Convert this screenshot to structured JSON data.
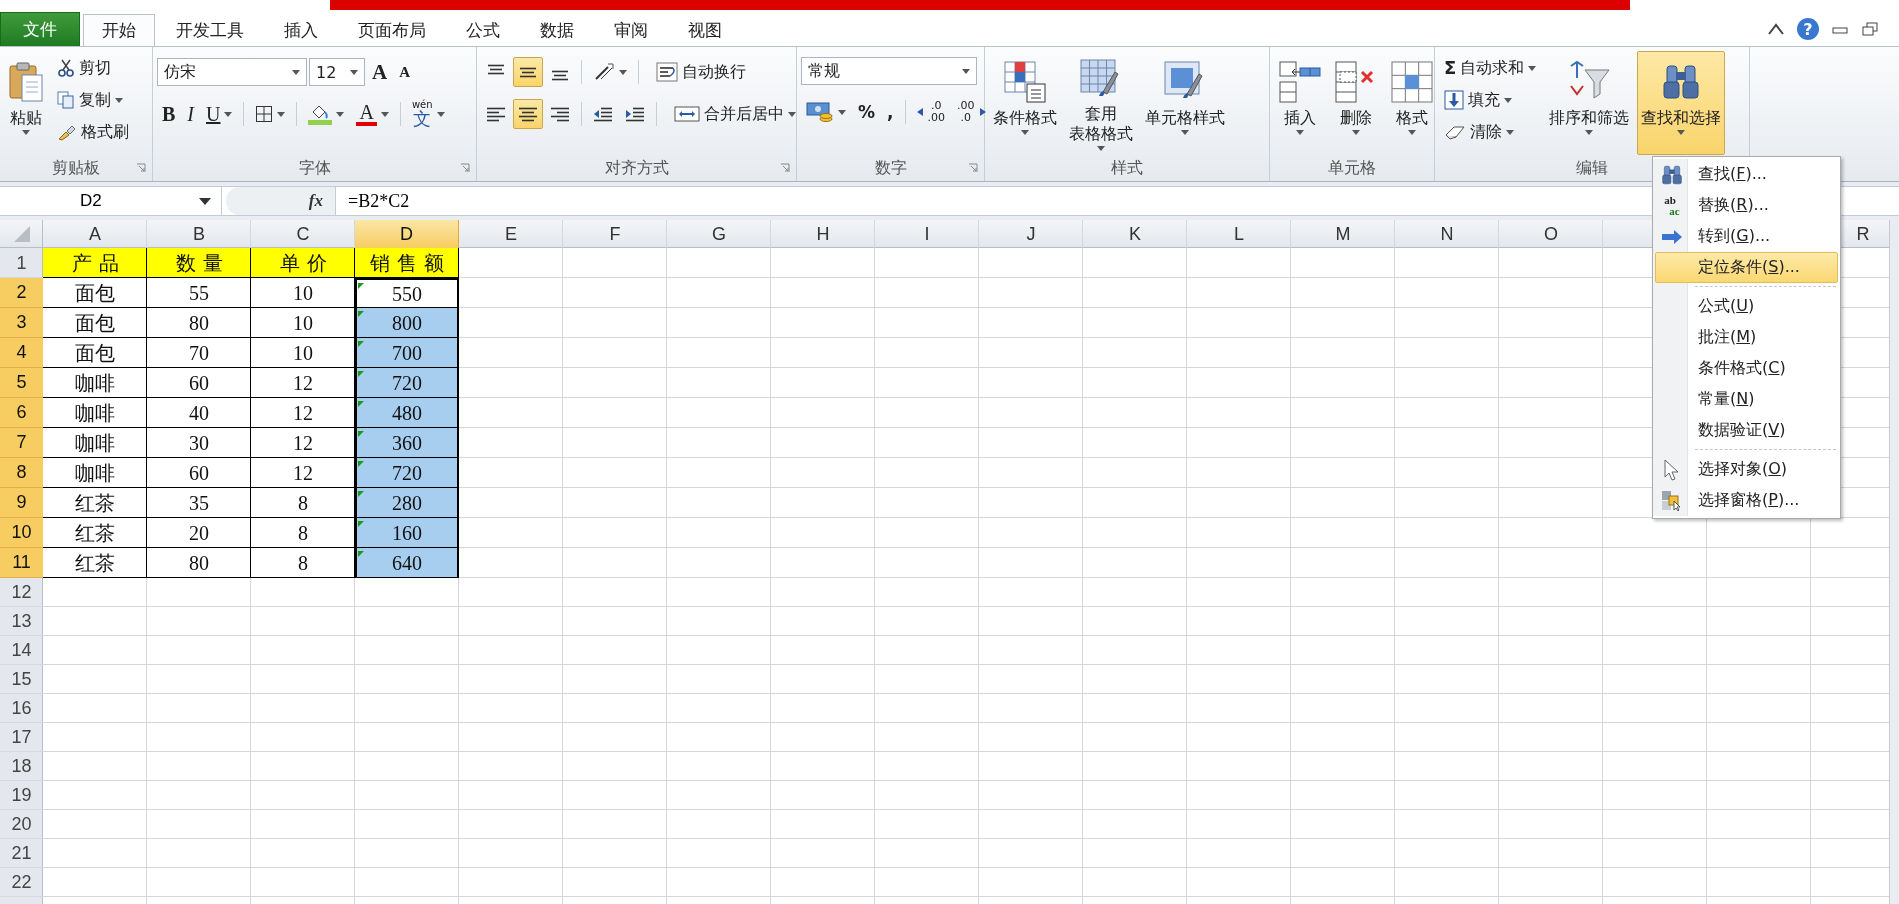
{
  "title_bar": {
    "help": "?"
  },
  "tabs": [
    {
      "label": "文件",
      "kind": "file",
      "selected": false
    },
    {
      "label": "开始",
      "kind": "tab",
      "selected": true
    },
    {
      "label": "开发工具",
      "kind": "tab",
      "selected": false
    },
    {
      "label": "插入",
      "kind": "tab",
      "selected": false
    },
    {
      "label": "页面布局",
      "kind": "tab",
      "selected": false
    },
    {
      "label": "公式",
      "kind": "tab",
      "selected": false
    },
    {
      "label": "数据",
      "kind": "tab",
      "selected": false
    },
    {
      "label": "审阅",
      "kind": "tab",
      "selected": false
    },
    {
      "label": "视图",
      "kind": "tab",
      "selected": false
    }
  ],
  "ribbon": [
    {
      "label": "剪贴板",
      "launcher": true,
      "controls": [
        {
          "kind": "paste",
          "lines": [
            "粘贴"
          ],
          "dropdown": true,
          "pressed": false
        },
        {
          "kind": "stack",
          "items": [
            {
              "kind": "cut",
              "label": "剪切",
              "dropdown": false
            },
            {
              "kind": "copy",
              "label": "复制",
              "dropdown": true
            },
            {
              "kind": "painter",
              "label": "格式刷",
              "dropdown": false
            }
          ]
        }
      ]
    },
    {
      "label": "字体",
      "launcher": true,
      "controls": [
        {
          "kind": "rows",
          "rows": [
            {
              "items": [
                {
                  "kind": "font-field",
                  "value": "仿宋"
                },
                {
                  "kind": "size-field",
                  "value": "12"
                },
                {
                  "kind": "grow",
                  "glyph": "A"
                },
                {
                  "kind": "shrink",
                  "glyph": "A"
                }
              ]
            },
            {
              "items": [
                {
                  "kind": "bold",
                  "glyph": "B"
                },
                {
                  "kind": "italic",
                  "glyph": "I"
                },
                {
                  "kind": "underline",
                  "glyph": "U",
                  "dropdown": true
                },
                {
                  "kind": "sep"
                },
                {
                  "kind": "border",
                  "dropdown": true
                },
                {
                  "kind": "sep"
                },
                {
                  "kind": "fill",
                  "dropdown": true
                },
                {
                  "kind": "font-color",
                  "glyph": "A",
                  "dropdown": true
                },
                {
                  "kind": "sep"
                },
                {
                  "kind": "phonetic",
                  "glyph": "文",
                  "sup": "wén",
                  "dropdown": true
                }
              ]
            }
          ]
        }
      ]
    },
    {
      "label": "对齐方式",
      "launcher": true,
      "controls": [
        {
          "kind": "rows",
          "rows": [
            {
              "items": [
                {
                  "kind": "align-top",
                  "pressed": false
                },
                {
                  "kind": "align-middle",
                  "pressed": true
                },
                {
                  "kind": "align-bottom",
                  "pressed": false
                },
                {
                  "kind": "sep"
                },
                {
                  "kind": "orientation",
                  "dropdown": true
                },
                {
                  "kind": "sep"
                },
                {
                  "kind": "wrap",
                  "label": "自动换行"
                }
              ]
            },
            {
              "items": [
                {
                  "kind": "align-left",
                  "pressed": false
                },
                {
                  "kind": "align-center",
                  "pressed": true
                },
                {
                  "kind": "align-right",
                  "pressed": false
                },
                {
                  "kind": "sep"
                },
                {
                  "kind": "indent-less"
                },
                {
                  "kind": "indent-more"
                },
                {
                  "kind": "sep"
                },
                {
                  "kind": "merge",
                  "label": "合并后居中",
                  "dropdown": true
                }
              ]
            }
          ]
        }
      ]
    },
    {
      "label": "数字",
      "launcher": true,
      "controls": [
        {
          "kind": "rows",
          "rows": [
            {
              "items": [
                {
                  "kind": "format-field",
                  "value": "常规"
                }
              ]
            },
            {
              "items": [
                {
                  "kind": "currency",
                  "dropdown": true
                },
                {
                  "kind": "percent",
                  "glyph": "%"
                },
                {
                  "kind": "comma",
                  "glyph": ","
                },
                {
                  "kind": "sep"
                },
                {
                  "kind": "decimal-more",
                  "glyph": ".0",
                  "glyph2": ".00"
                },
                {
                  "kind": "decimal-less",
                  "glyph": ".00",
                  "glyph2": ".0"
                }
              ]
            }
          ]
        }
      ]
    },
    {
      "label": "样式",
      "launcher": false,
      "controls": [
        {
          "kind": "conditional",
          "lines": [
            "条件格式"
          ],
          "dropdown": true,
          "pressed": false
        },
        {
          "kind": "table-format",
          "lines": [
            "套用",
            "表格格式"
          ],
          "dropdown": true,
          "pressed": false
        },
        {
          "kind": "cell-styles",
          "lines": [
            "单元格样式"
          ],
          "dropdown": true,
          "pressed": false
        }
      ]
    },
    {
      "label": "单元格",
      "launcher": false,
      "controls": [
        {
          "kind": "insert",
          "lines": [
            "插入"
          ],
          "dropdown": true,
          "pressed": false
        },
        {
          "kind": "delete",
          "lines": [
            "删除"
          ],
          "dropdown": true,
          "pressed": false
        },
        {
          "kind": "format",
          "lines": [
            "格式"
          ],
          "dropdown": true,
          "pressed": false
        }
      ]
    },
    {
      "label": "编辑",
      "launcher": false,
      "controls": [
        {
          "kind": "stack",
          "items": [
            {
              "kind": "autosum",
              "glyph": "Σ",
              "label": "自动求和",
              "dropdown": true
            },
            {
              "kind": "fill-down",
              "label": "填充",
              "dropdown": true
            },
            {
              "kind": "clear",
              "label": "清除",
              "dropdown": true
            }
          ]
        },
        {
          "kind": "sort-filter",
          "lines": [
            "排序和筛选"
          ],
          "dropdown": true,
          "pressed": false
        },
        {
          "kind": "find",
          "lines": [
            "查找和选择"
          ],
          "dropdown": true,
          "pressed": true
        }
      ]
    }
  ],
  "formula_bar": {
    "name_box": "D2",
    "fx": "fx",
    "formula": "=B2*C2"
  },
  "sheet": {
    "columns": [
      {
        "label": "A",
        "highlighted": false
      },
      {
        "label": "B",
        "highlighted": false
      },
      {
        "label": "C",
        "highlighted": false
      },
      {
        "label": "D",
        "highlighted": true
      },
      {
        "label": "E",
        "highlighted": false
      },
      {
        "label": "F",
        "highlighted": false
      },
      {
        "label": "G",
        "highlighted": false
      },
      {
        "label": "H",
        "highlighted": false
      },
      {
        "label": "I",
        "highlighted": false
      },
      {
        "label": "J",
        "highlighted": false
      },
      {
        "label": "K",
        "highlighted": false
      },
      {
        "label": "L",
        "highlighted": false
      },
      {
        "label": "M",
        "highlighted": false
      },
      {
        "label": "N",
        "highlighted": false
      },
      {
        "label": "O",
        "highlighted": false
      },
      {
        "highlighted": false
      },
      {
        "label": "R",
        "highlighted": false
      }
    ],
    "rows": [
      {
        "row": "1",
        "kind": "header",
        "highlighted": false,
        "cells": [
          "产品",
          "数量",
          "单价"
        ],
        "d": {
          "text": "销售额",
          "selected": false,
          "active": false,
          "flagged": false
        }
      },
      {
        "row": "2",
        "kind": "data",
        "highlighted": true,
        "cells": [
          "面包",
          "55",
          "10"
        ],
        "d": {
          "text": "550",
          "selected": true,
          "active": true,
          "flagged": true
        }
      },
      {
        "row": "3",
        "kind": "data",
        "highlighted": true,
        "cells": [
          "面包",
          "80",
          "10"
        ],
        "d": {
          "text": "800",
          "selected": true,
          "active": false,
          "flagged": true
        }
      },
      {
        "row": "4",
        "kind": "data",
        "highlighted": true,
        "cells": [
          "面包",
          "70",
          "10"
        ],
        "d": {
          "text": "700",
          "selected": true,
          "active": false,
          "flagged": true
        }
      },
      {
        "row": "5",
        "kind": "data",
        "highlighted": true,
        "cells": [
          "咖啡",
          "60",
          "12"
        ],
        "d": {
          "text": "720",
          "selected": true,
          "active": false,
          "flagged": true
        }
      },
      {
        "row": "6",
        "kind": "data",
        "highlighted": true,
        "cells": [
          "咖啡",
          "40",
          "12"
        ],
        "d": {
          "text": "480",
          "selected": true,
          "active": false,
          "flagged": true
        }
      },
      {
        "row": "7",
        "kind": "data",
        "highlighted": true,
        "cells": [
          "咖啡",
          "30",
          "12"
        ],
        "d": {
          "text": "360",
          "selected": true,
          "active": false,
          "flagged": true
        }
      },
      {
        "row": "8",
        "kind": "data",
        "highlighted": true,
        "cells": [
          "咖啡",
          "60",
          "12"
        ],
        "d": {
          "text": "720",
          "selected": true,
          "active": false,
          "flagged": true
        }
      },
      {
        "row": "9",
        "kind": "data",
        "highlighted": true,
        "cells": [
          "红茶",
          "35",
          "8"
        ],
        "d": {
          "text": "280",
          "selected": true,
          "active": false,
          "flagged": true
        }
      },
      {
        "row": "10",
        "kind": "data",
        "highlighted": true,
        "cells": [
          "红茶",
          "20",
          "8"
        ],
        "d": {
          "text": "160",
          "selected": true,
          "active": false,
          "flagged": true
        }
      },
      {
        "row": "11",
        "kind": "data",
        "highlighted": true,
        "cells": [
          "红茶",
          "80",
          "8"
        ],
        "d": {
          "text": "640",
          "selected": true,
          "active": false,
          "flagged": true
        }
      },
      {
        "row": "12",
        "kind": "empty",
        "highlighted": false
      },
      {
        "row": "13",
        "kind": "empty",
        "highlighted": false
      },
      {
        "row": "14",
        "kind": "empty",
        "highlighted": false
      },
      {
        "row": "15",
        "kind": "empty",
        "highlighted": false
      },
      {
        "row": "16",
        "kind": "empty",
        "highlighted": false
      },
      {
        "row": "17",
        "kind": "empty",
        "highlighted": false
      },
      {
        "row": "18",
        "kind": "empty",
        "highlighted": false
      },
      {
        "row": "19",
        "kind": "empty",
        "highlighted": false
      },
      {
        "row": "20",
        "kind": "empty",
        "highlighted": false
      },
      {
        "row": "21",
        "kind": "empty",
        "highlighted": false
      },
      {
        "row": "22",
        "kind": "empty",
        "highlighted": false
      }
    ]
  },
  "menu": {
    "items": [
      {
        "kind": "find",
        "text": "查找(",
        "key": "F",
        "tail": ")...",
        "selected": false
      },
      {
        "kind": "replace",
        "glyph": "ab",
        "glyph2": "ac",
        "text": "替换(",
        "key": "R",
        "tail": ")...",
        "selected": false
      },
      {
        "kind": "goto",
        "text": "转到(",
        "key": "G",
        "tail": ")...",
        "selected": false
      },
      {
        "kind": "plain",
        "text": "定位条件(",
        "key": "S",
        "tail": ")...",
        "selected": true
      },
      {
        "kind": "separator"
      },
      {
        "kind": "plain",
        "text": "公式(",
        "key": "U",
        "tail": ")",
        "selected": false
      },
      {
        "kind": "plain",
        "text": "批注(",
        "key": "M",
        "tail": ")",
        "selected": false
      },
      {
        "kind": "plain",
        "text": "条件格式(",
        "key": "C",
        "tail": ")",
        "selected": false
      },
      {
        "kind": "plain",
        "text": "常量(",
        "key": "N",
        "tail": ")",
        "selected": false
      },
      {
        "kind": "plain",
        "text": "数据验证(",
        "key": "V",
        "tail": ")",
        "selected": false
      },
      {
        "kind": "separator"
      },
      {
        "kind": "select-objects",
        "text": "选择对象(",
        "key": "O",
        "tail": ")",
        "selected": false
      },
      {
        "kind": "selection-pane",
        "text": "选择窗格(",
        "key": "P",
        "tail": ")...",
        "selected": false
      }
    ]
  }
}
